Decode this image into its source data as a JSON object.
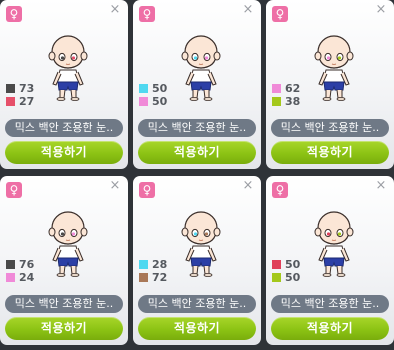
{
  "cards": [
    {
      "gender_icon": "female-icon",
      "mix": [
        {
          "color": "#4a4a4a",
          "pct": "73"
        },
        {
          "color": "#e6506a",
          "pct": "27"
        }
      ],
      "name": "믹스 백안 조용한 눈..",
      "apply_label": "적용하기"
    },
    {
      "gender_icon": "female-icon",
      "mix": [
        {
          "color": "#4fd8f0",
          "pct": "50"
        },
        {
          "color": "#f08ad8",
          "pct": "50"
        }
      ],
      "name": "믹스 백안 조용한 눈..",
      "apply_label": "적용하기"
    },
    {
      "gender_icon": "female-icon",
      "mix": [
        {
          "color": "#f08ad8",
          "pct": "62"
        },
        {
          "color": "#a4c81c",
          "pct": "38"
        }
      ],
      "name": "믹스 백안 조용한 눈..",
      "apply_label": "적용하기"
    },
    {
      "gender_icon": "female-icon",
      "mix": [
        {
          "color": "#4a4a4a",
          "pct": "76"
        },
        {
          "color": "#f08ad8",
          "pct": "24"
        }
      ],
      "name": "믹스 백안 조용한 눈..",
      "apply_label": "적용하기"
    },
    {
      "gender_icon": "female-icon",
      "mix": [
        {
          "color": "#4fd8f0",
          "pct": "28"
        },
        {
          "color": "#a97858",
          "pct": "72"
        }
      ],
      "name": "믹스 백안 조용한 눈..",
      "apply_label": "적용하기"
    },
    {
      "gender_icon": "female-icon",
      "mix": [
        {
          "color": "#e0405a",
          "pct": "50"
        },
        {
          "color": "#a4c81c",
          "pct": "50"
        }
      ],
      "name": "믹스 백안 조용한 눈..",
      "apply_label": "적용하기"
    }
  ],
  "glyphs": {
    "female": "♀",
    "close": "×"
  },
  "colors": {
    "gender_badge": "#ee6fa6",
    "name_bar": "#6f7986",
    "apply_button": "#8cc314"
  }
}
